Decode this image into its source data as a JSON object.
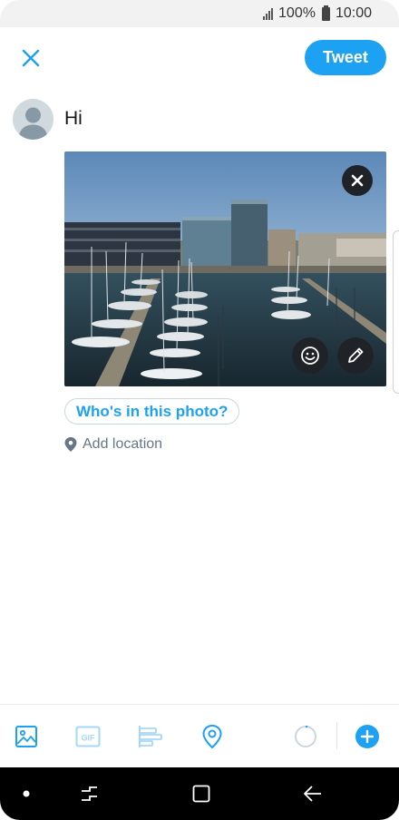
{
  "status_bar": {
    "battery_percent": "100%",
    "time": "10:00",
    "signal_icon": "signal-bars-icon",
    "battery_icon": "battery-icon"
  },
  "compose": {
    "close_icon": "close-icon",
    "tweet_button_label": "Tweet",
    "avatar_icon": "default-avatar-icon",
    "tweet_text": "Hi"
  },
  "media": {
    "remove_icon": "close-circle-icon",
    "sticker_icon": "smiley-icon",
    "edit_icon": "pencil-icon",
    "tag_people_label": "Who's in this photo?",
    "location_icon": "location-pin-icon",
    "add_location_label": "Add location"
  },
  "toolbar": {
    "items": [
      "image-icon",
      "gif-icon",
      "poll-icon",
      "location-icon",
      "character-count-ring-icon",
      "add-thread-icon"
    ],
    "gif_label": "GIF",
    "accent_color": "#1da1f2"
  },
  "nav_bar": {
    "items": [
      "dot-icon",
      "recent-apps-icon",
      "home-icon",
      "back-icon"
    ]
  }
}
